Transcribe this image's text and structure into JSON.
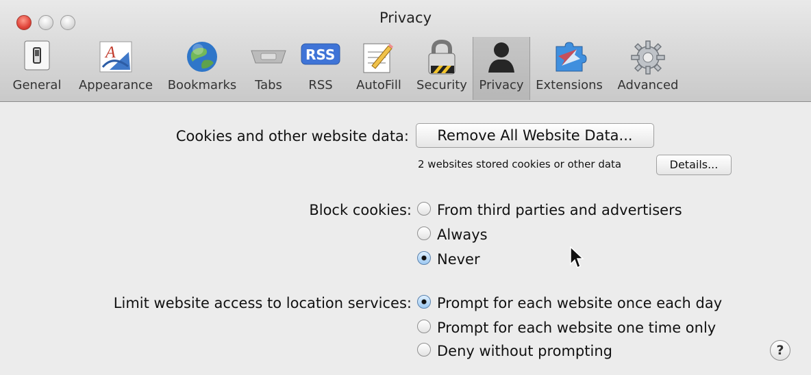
{
  "window": {
    "title": "Privacy"
  },
  "toolbar": {
    "items": [
      {
        "label": "General",
        "icon": "light-switch-icon"
      },
      {
        "label": "Appearance",
        "icon": "font-appearance-icon"
      },
      {
        "label": "Bookmarks",
        "icon": "globe-icon"
      },
      {
        "label": "Tabs",
        "icon": "tabs-icon"
      },
      {
        "label": "RSS",
        "icon": "rss-icon"
      },
      {
        "label": "AutoFill",
        "icon": "pencil-form-icon"
      },
      {
        "label": "Security",
        "icon": "lock-icon"
      },
      {
        "label": "Privacy",
        "icon": "person-silhouette-icon"
      },
      {
        "label": "Extensions",
        "icon": "puzzle-compass-icon"
      },
      {
        "label": "Advanced",
        "icon": "gear-icon"
      }
    ],
    "selected": "Privacy"
  },
  "cookies": {
    "label": "Cookies and other website data:",
    "remove_button": "Remove All Website Data...",
    "status": "2 websites stored cookies or other data",
    "details_button": "Details..."
  },
  "block_cookies": {
    "label": "Block cookies:",
    "options": [
      "From third parties and advertisers",
      "Always",
      "Never"
    ],
    "selected": "Never"
  },
  "location": {
    "label": "Limit website access to location services:",
    "options": [
      "Prompt for each website once each day",
      "Prompt for each website one time only",
      "Deny without prompting"
    ],
    "selected": "Prompt for each website once each day"
  },
  "help": {
    "label": "?"
  },
  "colors": {
    "selected_radio": "#9dc9f2",
    "close_button": "#e0443a"
  }
}
